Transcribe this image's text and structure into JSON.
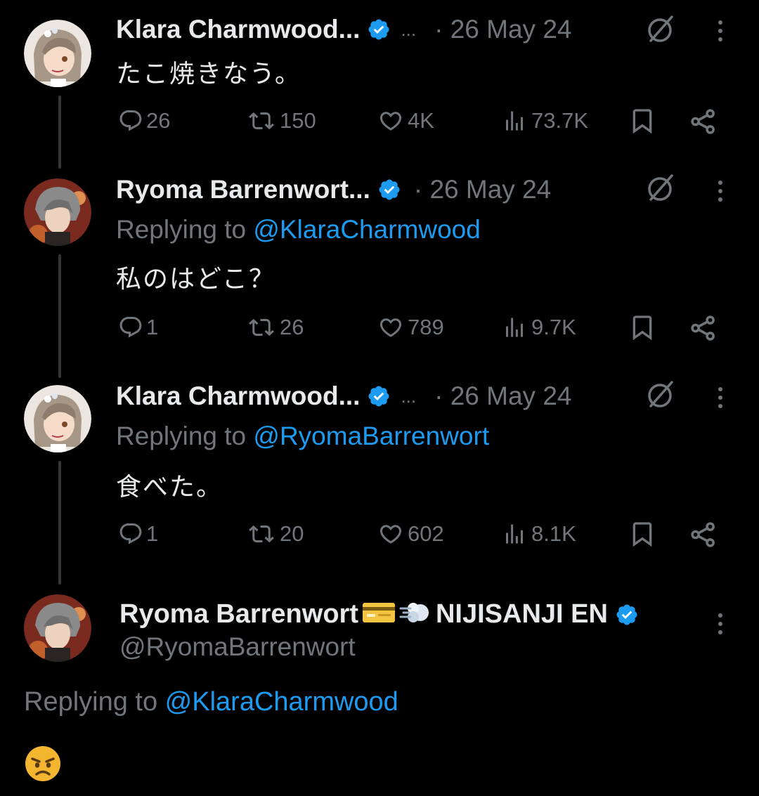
{
  "tweets": [
    {
      "author": "Klara Charmwood...",
      "extra_dots": "...",
      "date": "· 26 May 24",
      "replying_prefix": "",
      "replying_handle": "",
      "text": "たこ焼きなう。",
      "replies": "26",
      "reposts": "150",
      "likes": "4K",
      "views": "73.7K"
    },
    {
      "author": "Ryoma Barrenwort...",
      "extra_dots": "",
      "date": "· 26 May 24",
      "replying_prefix": "Replying to ",
      "replying_handle": "@KlaraCharmwood",
      "text": "私のはどこ？",
      "replies": "1",
      "reposts": "26",
      "likes": "789",
      "views": "9.7K"
    },
    {
      "author": "Klara Charmwood...",
      "extra_dots": "...",
      "date": "· 26 May 24",
      "replying_prefix": "Replying to ",
      "replying_handle": "@RyomaBarrenwort",
      "text": "食べた。",
      "replies": "1",
      "reposts": "20",
      "likes": "602",
      "views": "8.1K"
    }
  ],
  "main_tweet": {
    "author": "Ryoma Barrenwort",
    "author_suffix": "NIJISANJI EN",
    "handle": "@RyomaBarrenwort",
    "replying_prefix": "Replying to ",
    "replying_handle": "@KlaraCharmwood",
    "content_icon": "angry-face-emoji"
  },
  "colors": {
    "background": "#000000",
    "text": "#e7e9ea",
    "muted": "#71767b",
    "accent": "#1d9bf0",
    "thread_line": "#333639"
  }
}
